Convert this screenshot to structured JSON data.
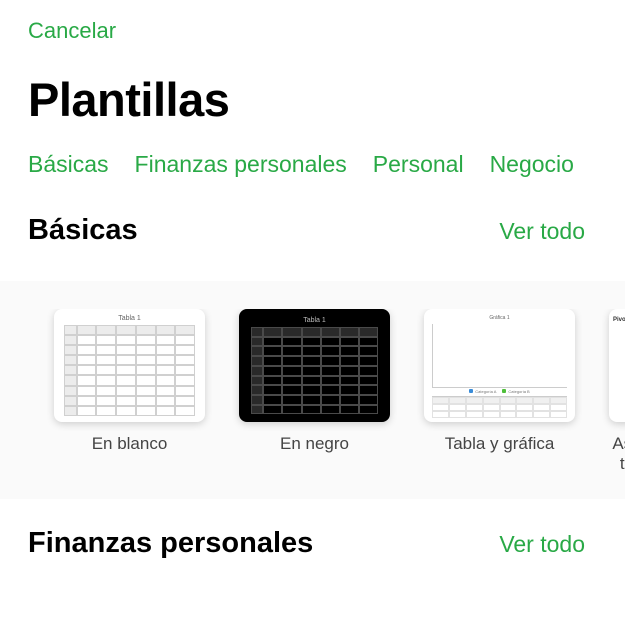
{
  "header": {
    "cancel": "Cancelar",
    "title": "Plantillas"
  },
  "tabs": [
    "Básicas",
    "Finanzas personales",
    "Personal",
    "Negocio"
  ],
  "sections": {
    "basic": {
      "title": "Básicas",
      "see_all": "Ver todo",
      "templates": [
        {
          "label": "En blanco"
        },
        {
          "label": "En negro"
        },
        {
          "label": "Tabla y gráfica"
        },
        {
          "label_line1": "Asp",
          "label_line2": "ta"
        }
      ]
    },
    "finance": {
      "title": "Finanzas personales",
      "see_all": "Ver todo"
    }
  },
  "colors": {
    "accent": "#29a946",
    "chart_blue": "#3a8cd8",
    "chart_green": "#4fbf3a"
  }
}
